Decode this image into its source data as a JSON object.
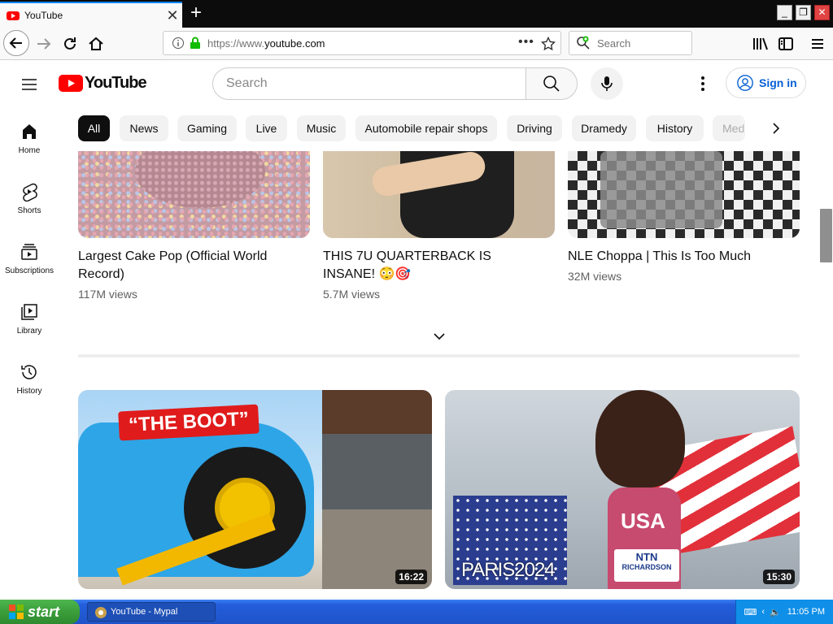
{
  "browser": {
    "tab_title": "YouTube",
    "url_protocol": "https://www.",
    "url_domain": "youtube.com",
    "search_placeholder": "Search",
    "new_tab_glyph": "+",
    "close_glyph": "✕"
  },
  "youtube": {
    "logo_text": "YouTube",
    "search_placeholder": "Search",
    "sign_in_label": "Sign in",
    "chips": [
      "All",
      "News",
      "Gaming",
      "Live",
      "Music",
      "Automobile repair shops",
      "Driving",
      "Dramedy",
      "History",
      "Med"
    ],
    "sidebar": [
      {
        "label": "Home",
        "icon": "home-icon"
      },
      {
        "label": "Shorts",
        "icon": "shorts-icon"
      },
      {
        "label": "Subscriptions",
        "icon": "subscriptions-icon"
      },
      {
        "label": "Library",
        "icon": "library-icon"
      },
      {
        "label": "History",
        "icon": "history-icon"
      }
    ],
    "shorts": [
      {
        "title": "Largest Cake Pop (Official World Record)",
        "views": "117M views"
      },
      {
        "title": "THIS 7U QUARTERBACK IS INSANE! 😳🎯",
        "views": "5.7M views"
      },
      {
        "title": "NLE Choppa | This Is Too Much",
        "views": "32M views"
      }
    ],
    "videos": [
      {
        "duration": "16:22",
        "overlay_text": "“THE BOOT”"
      },
      {
        "duration": "15:30",
        "overlay_text": "PARIS2024",
        "jersey_text": "USA",
        "bib_text": "RICHARDSON",
        "sponsor_text": "NTN"
      }
    ]
  },
  "taskbar": {
    "start_label": "start",
    "task_label": "YouTube - Mypal",
    "clock": "11:05 PM"
  },
  "colors": {
    "yt_red": "#ff0000",
    "link_blue": "#065fd4",
    "chip_bg": "#f2f2f2"
  }
}
